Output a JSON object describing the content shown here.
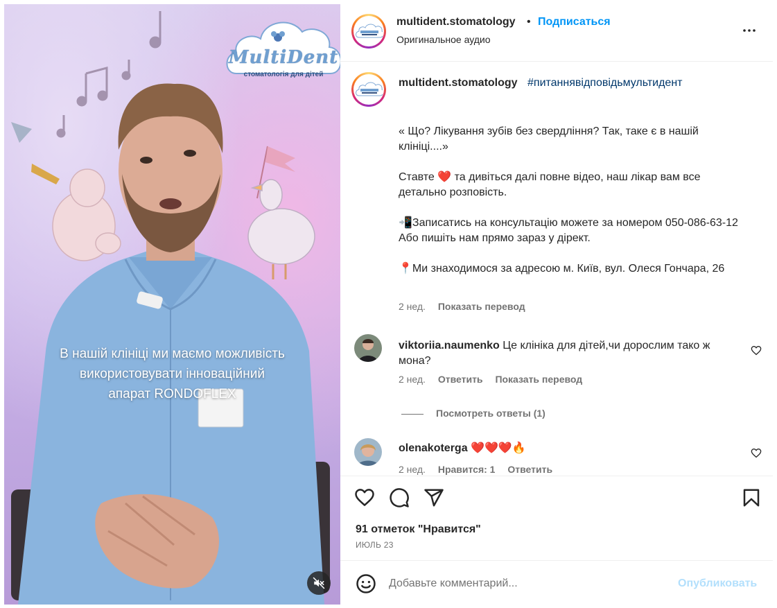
{
  "video": {
    "logo_title": "MultiDent",
    "logo_subtitle": "стоматологія для дітей",
    "subtitle_lines": [
      "В нашій клініці ми маємо можливість",
      "використовувати інноваційний",
      "апарат RONDOFLEX"
    ],
    "mute_icon": "speaker-muted-icon"
  },
  "header": {
    "username": "multident.stomatology",
    "separator": "•",
    "follow_label": "Подписаться",
    "audio_label": "Оригинальное аудио",
    "more_icon": "more-horizontal-icon"
  },
  "caption": {
    "username": "multident.stomatology",
    "hashtag": "#питаннявідповідьмультидент",
    "paragraphs": [
      "« Що? Лікування зубів без свердління? Так, таке є в нашій клініці....»",
      "Ставте ❤️ та дивіться далі повне відео, наш лікар вам все детально розповість.",
      "📲Записатись на консультацію можете за номером 050-086-63-12\nАбо пишіть нам прямо зараз у дірект.",
      "📍Ми знаходимося за адресою м. Київ, вул. Олеся Гончара, 26"
    ],
    "time": "2 нед.",
    "translate_label": "Показать перевод"
  },
  "comments": [
    {
      "username": "viktoriia.naumenko",
      "text": "Це клініка для дітей,чи дорослим тако ж мона?",
      "time": "2 нед.",
      "reply_label": "Ответить",
      "translate_label": "Показать перевод",
      "view_replies": "Посмотреть ответы (1)"
    },
    {
      "username": "olenakoterga",
      "text": "❤️❤️❤️🔥",
      "time": "2 нед.",
      "likes_label": "Нравится: 1",
      "reply_label": "Ответить"
    }
  ],
  "actions": {
    "like_icon": "heart-icon",
    "comment_icon": "comment-icon",
    "share_icon": "paper-plane-icon",
    "save_icon": "bookmark-icon",
    "likes_text": "91 отметок \"Нравится\"",
    "date_text": "ИЮЛЬ 23"
  },
  "add_comment": {
    "emoji_icon": "smiley-icon",
    "placeholder": "Добавьте комментарий...",
    "publish_label": "Опубликовать"
  },
  "colors": {
    "link_blue": "#0095f6",
    "publish_disabled": "#b2dffc",
    "hashtag": "#00376b",
    "muted_text": "#737373",
    "border": "#efefef"
  }
}
